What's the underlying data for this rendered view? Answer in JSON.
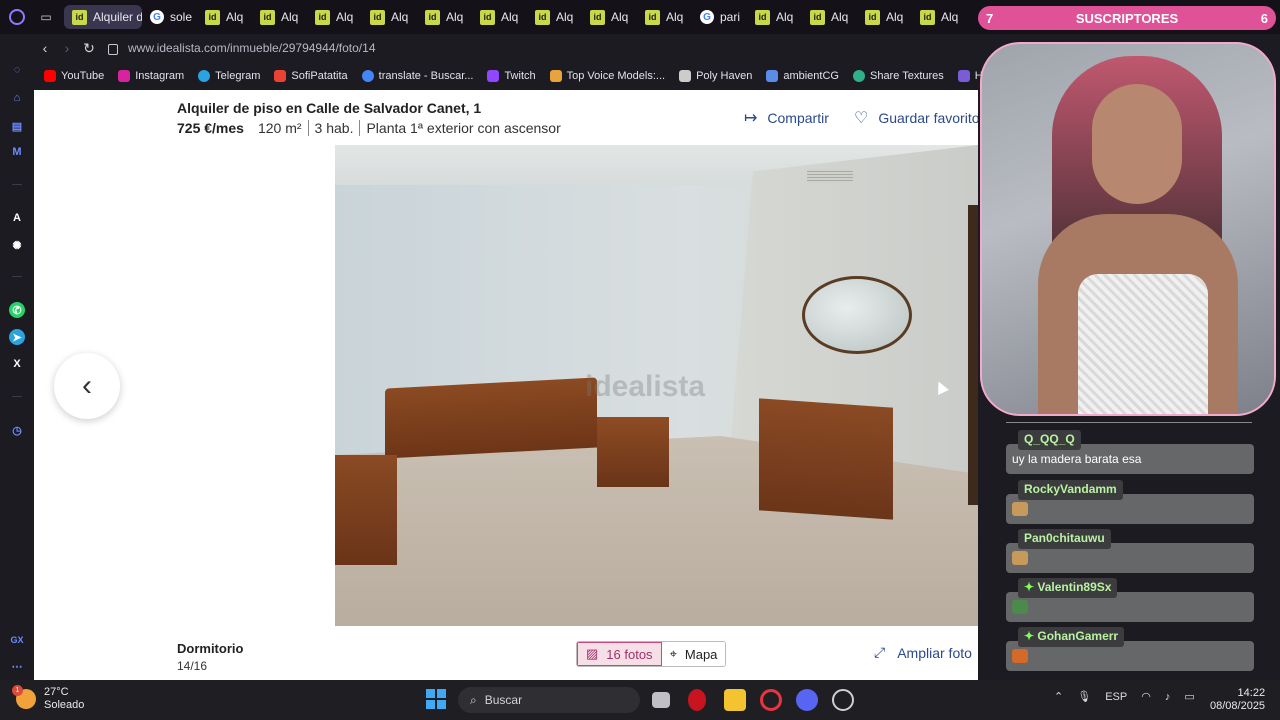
{
  "browser": {
    "tabs": [
      {
        "label": "Alquiler d",
        "favicon": "idealista",
        "active": true
      },
      {
        "label": "sole",
        "favicon": "google"
      },
      {
        "label": "Alq",
        "favicon": "idealista"
      },
      {
        "label": "Alq",
        "favicon": "idealista"
      },
      {
        "label": "Alq",
        "favicon": "idealista"
      },
      {
        "label": "Alq",
        "favicon": "idealista"
      },
      {
        "label": "Alq",
        "favicon": "idealista"
      },
      {
        "label": "Alq",
        "favicon": "idealista"
      },
      {
        "label": "Alq",
        "favicon": "idealista"
      },
      {
        "label": "Alq",
        "favicon": "idealista"
      },
      {
        "label": "Alq",
        "favicon": "idealista"
      },
      {
        "label": "pari",
        "favicon": "google"
      },
      {
        "label": "Alq",
        "favicon": "idealista"
      },
      {
        "label": "Alq",
        "favicon": "idealista"
      },
      {
        "label": "Alq",
        "favicon": "idealista"
      },
      {
        "label": "Alq",
        "favicon": "idealista"
      }
    ],
    "url": "www.idealista.com/inmueble/29794944/foto/14",
    "bookmarks": [
      {
        "label": "YouTube",
        "color": "#ff0000"
      },
      {
        "label": "Instagram",
        "color": "#d6249f"
      },
      {
        "label": "Telegram",
        "color": "#2aa3df"
      },
      {
        "label": "SofiPatatita",
        "color": "#ea4335"
      },
      {
        "label": "translate - Buscar...",
        "color": "#4285f4"
      },
      {
        "label": "Twitch",
        "color": "#9146ff"
      },
      {
        "label": "Top Voice Models:...",
        "color": "#e8a33c"
      },
      {
        "label": "Poly Haven",
        "color": "#cccccc"
      },
      {
        "label": "ambientCG",
        "color": "#5b8de8"
      },
      {
        "label": "Share Textures",
        "color": "#2fb08a"
      },
      {
        "label": "Har",
        "color": "#7a5cd6"
      }
    ]
  },
  "listing": {
    "title": "Alquiler de piso en Calle de Salvador Canet, 1",
    "price": "725 €/mes",
    "area": "120 m²",
    "rooms": "3 hab.",
    "floor": "Planta 1ª exterior con ascensor",
    "share_label": "Compartir",
    "save_label": "Guardar favorito",
    "photo_watermark": "idealista",
    "photo_caption": "Dormitorio",
    "photo_counter": "14/16",
    "photos_button": "16 fotos",
    "map_button": "Mapa",
    "enlarge_label": "Ampliar foto"
  },
  "overlay": {
    "subs_count_left": "7",
    "subs_label": "SUSCRIPTORES",
    "subs_count_right": "6",
    "chat": [
      {
        "user": "Q_QQ_Q",
        "message": "uy la madera barata esa",
        "emote": false
      },
      {
        "user": "RockyVandamm",
        "message": "",
        "emote": true
      },
      {
        "user": "Pan0chitauwu",
        "message": "",
        "emote": true
      },
      {
        "user": "Valentin89Sx",
        "message": "",
        "emote": true,
        "badge": true
      },
      {
        "user": "GohanGamerr",
        "message": "",
        "emote": true,
        "badge": true
      }
    ]
  },
  "taskbar": {
    "temperature": "27°C",
    "weather": "Soleado",
    "weather_badge": "1",
    "search_placeholder": "Buscar",
    "language": "ESP",
    "time": "14:22",
    "date": "08/08/2025"
  }
}
